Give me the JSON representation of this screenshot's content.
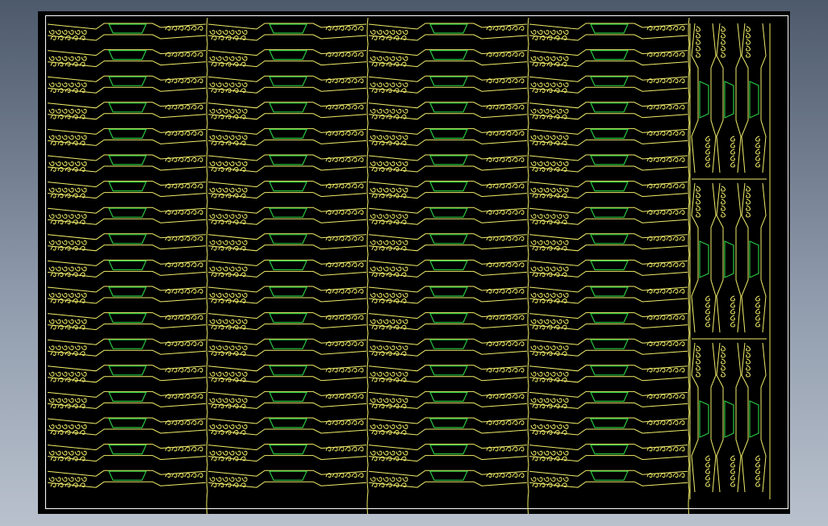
{
  "viewer": {
    "background_gradient": [
      "#4d5a6c",
      "#b9c1cd"
    ],
    "model_space_color": "#000000"
  },
  "drawing": {
    "type": "cad-nesting-layout",
    "sheet_border_color": "#ffffff",
    "part_outline_color": "#f2ee6a",
    "inner_cutout_color": "#27c93f",
    "main_nest": {
      "columns": 4,
      "rows": 18,
      "cutout_shape": "trapezoid"
    },
    "side_nest": {
      "columns": 3,
      "groups": 3,
      "cutout_shape": "trapezoid"
    }
  }
}
